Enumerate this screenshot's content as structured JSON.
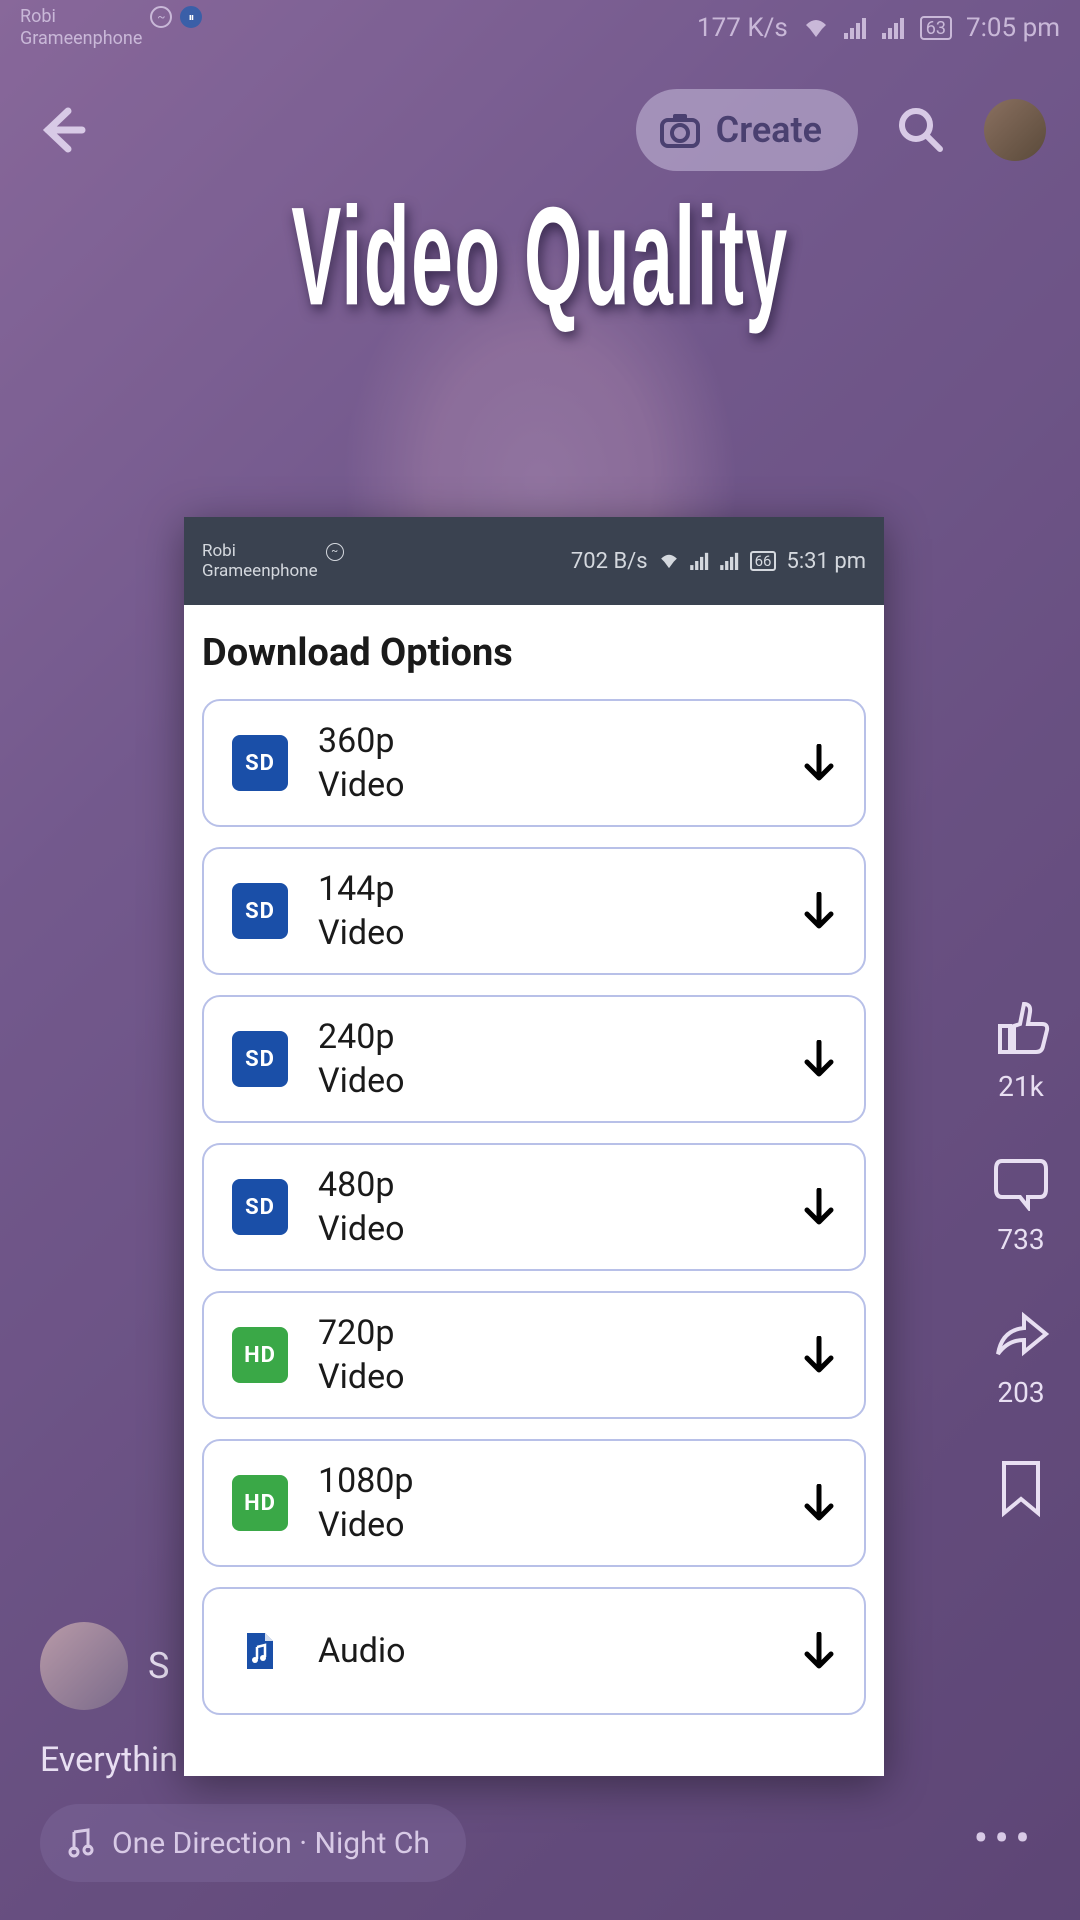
{
  "outerStatus": {
    "carrier1": "Robi",
    "carrier2": "Grameenphone",
    "speed": "177 K/s",
    "battery": "63",
    "time": "7:05 pm"
  },
  "header": {
    "createLabel": "Create"
  },
  "title": "Video Quality",
  "sideActions": {
    "likes": "21k",
    "comments": "733",
    "shares": "203"
  },
  "bottom": {
    "authorInitial": "S",
    "caption": "Everythin",
    "music": "One Direction · Night Ch"
  },
  "modal": {
    "status": {
      "carrier1": "Robi",
      "carrier2": "Grameenphone",
      "speed": "702 B/s",
      "battery": "66",
      "time": "5:31 pm"
    },
    "title": "Download Options",
    "options": [
      {
        "badge": "SD",
        "badgeClass": "badge-sd",
        "line1": "360p",
        "line2": "Video"
      },
      {
        "badge": "SD",
        "badgeClass": "badge-sd",
        "line1": "144p",
        "line2": "Video"
      },
      {
        "badge": "SD",
        "badgeClass": "badge-sd",
        "line1": "240p",
        "line2": "Video"
      },
      {
        "badge": "SD",
        "badgeClass": "badge-sd",
        "line1": "480p",
        "line2": "Video"
      },
      {
        "badge": "HD",
        "badgeClass": "badge-hd",
        "line1": "720p",
        "line2": "Video"
      },
      {
        "badge": "HD",
        "badgeClass": "badge-hd",
        "line1": "1080p",
        "line2": "Video"
      },
      {
        "badge": "♪",
        "badgeClass": "badge-audio",
        "line1": "Audio",
        "line2": ""
      }
    ]
  }
}
